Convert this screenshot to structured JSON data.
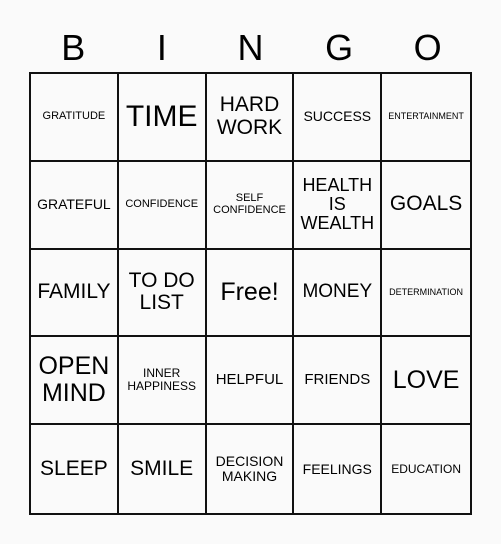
{
  "card": {
    "header_letters": [
      "B",
      "I",
      "N",
      "G",
      "O"
    ],
    "rows": [
      [
        {
          "text": "GRATITUDE",
          "size": "sz-s"
        },
        {
          "text": "TIME",
          "size": "sz-xxxl"
        },
        {
          "text": "HARD WORK",
          "size": "sz-xl"
        },
        {
          "text": "SUCCESS",
          "size": "sz-m"
        },
        {
          "text": "ENTERTAINMENT",
          "size": "sz-xs"
        }
      ],
      [
        {
          "text": "GRATEFUL",
          "size": "sz-m"
        },
        {
          "text": "CONFIDENCE",
          "size": "sz-s"
        },
        {
          "text": "SELF CONFIDENCE",
          "size": "sz-s"
        },
        {
          "text": "HEALTH IS WEALTH",
          "size": "sz-l"
        },
        {
          "text": "GOALS",
          "size": "sz-xl"
        }
      ],
      [
        {
          "text": "FAMILY",
          "size": "sz-xl"
        },
        {
          "text": "TO DO LIST",
          "size": "sz-xl"
        },
        {
          "text": "Free!",
          "size": "sz-xxl"
        },
        {
          "text": "MONEY",
          "size": "sz-l2"
        },
        {
          "text": "DETERMINATION",
          "size": "sz-xs"
        }
      ],
      [
        {
          "text": "OPEN MIND",
          "size": "sz-xxl"
        },
        {
          "text": "INNER HAPPINESS",
          "size": "sz-s2"
        },
        {
          "text": "HELPFUL",
          "size": "sz-m2"
        },
        {
          "text": "FRIENDS",
          "size": "sz-m2"
        },
        {
          "text": "LOVE",
          "size": "sz-xxl"
        }
      ],
      [
        {
          "text": "SLEEP",
          "size": "sz-xl"
        },
        {
          "text": "SMILE",
          "size": "sz-xl"
        },
        {
          "text": "DECISION MAKING",
          "size": "sz-m"
        },
        {
          "text": "FEELINGS",
          "size": "sz-m"
        },
        {
          "text": "EDUCATION",
          "size": "sz-s2"
        }
      ]
    ]
  }
}
